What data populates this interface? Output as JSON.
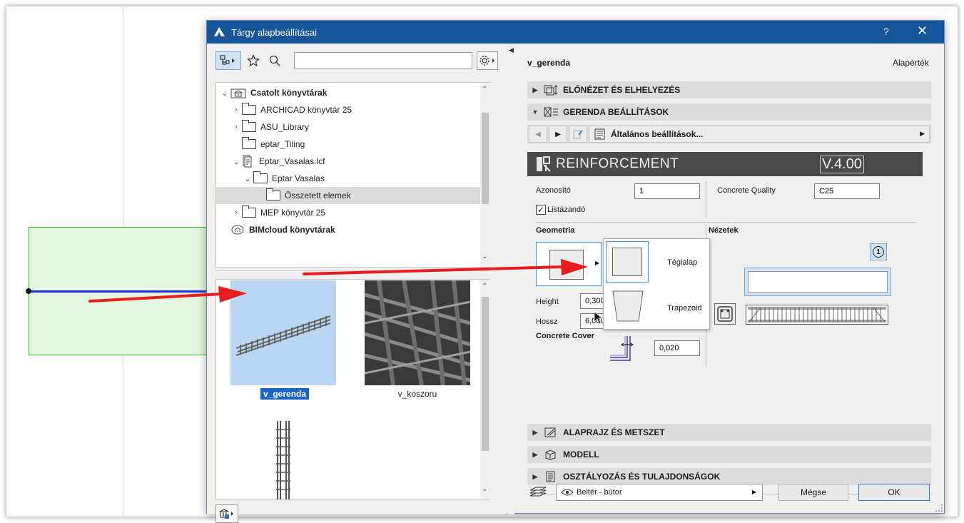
{
  "dialog": {
    "title": "Tárgy alapbeállításai",
    "help_label": "?",
    "close_label": "✕"
  },
  "library": {
    "search_placeholder": "",
    "tree": [
      {
        "label": "Csatolt könyvtárak",
        "bold": true
      },
      {
        "label": "ARCHICAD könyvtár 25"
      },
      {
        "label": "ASU_Library"
      },
      {
        "label": "eptar_Tiling"
      },
      {
        "label": "Eptar_Vasalas.lcf"
      },
      {
        "label": "Eptar Vasalas"
      },
      {
        "label": "Összetett elemek"
      },
      {
        "label": "MEP könyvtár 25"
      },
      {
        "label": "BIMcloud könyvtárak",
        "bold": true
      }
    ],
    "thumbs": [
      {
        "label": "v_gerenda",
        "selected": true
      },
      {
        "label": "v_koszoru"
      },
      {
        "label": ""
      }
    ]
  },
  "object": {
    "name": "v_gerenda",
    "default_label": "Alapérték"
  },
  "sections": {
    "preview": "ELŐNÉZET ÉS ELHELYEZÉS",
    "beam": "GERENDA BEÁLLÍTÁSOK",
    "plan": "ALAPRAJZ ÉS METSZET",
    "model": "MODELL",
    "classification": "OSZTÁLYOZÁS ÉS TULAJDONSÁGOK"
  },
  "subnav": {
    "page_label": "Általános beállítások..."
  },
  "gdl": {
    "banner_title": "REINFORCEMENT",
    "banner_version": "V.4.00",
    "id_label": "Azonosító",
    "id_value": "1",
    "concrete_quality_label": "Concrete Quality",
    "concrete_quality_value": "C25",
    "list_checkbox_label": "Listázandó",
    "list_checked": true,
    "geometry_label": "Geometria",
    "views_label": "Nézetek",
    "height_label": "Height",
    "height_value": "0,300",
    "length_label": "Hossz",
    "length_value": "6,000",
    "cover_label": "Concrete Cover",
    "cover_value": "0,020",
    "badge": "1",
    "popup_items": [
      "Téglalap",
      "Trapezoid"
    ]
  },
  "footer": {
    "layer_value": "Beltér - bútor",
    "cancel_label": "Mégse",
    "ok_label": "OK"
  },
  "colors": {
    "titlebar": "#17559b",
    "selection": "#b9d7f2",
    "arrow": "#e81c1c",
    "green_fill": "#e4f6df",
    "green_border": "#2fb52f",
    "line_blue": "#1f2fd8"
  }
}
